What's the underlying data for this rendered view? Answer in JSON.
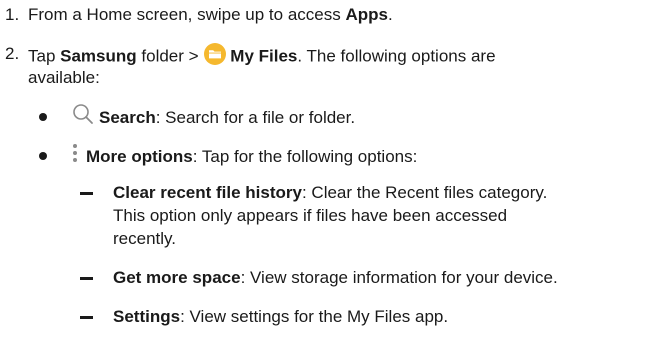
{
  "step1": {
    "number": "1.",
    "prefix": "From a Home screen, swipe up to access ",
    "bold": "Apps",
    "suffix": "."
  },
  "step2": {
    "number": "2.",
    "tap": "Tap ",
    "samsung": "Samsung",
    "folder_text": " folder > ",
    "folder_icon": "folder-icon",
    "myfiles": "My Files",
    "suffix_line1": ". The following options are",
    "line2": "available:"
  },
  "bullet1": {
    "icon": "search-icon",
    "label": "Search",
    "desc": ": Search for a file or folder."
  },
  "bullet2": {
    "icon": "more-options-icon",
    "label": "More options",
    "desc": ": Tap for the following options:"
  },
  "sub1": {
    "label": "Clear recent file history",
    "desc_line1": ": Clear the Recent files category.",
    "line2": "This option only appears if files have been accessed",
    "line3": "recently."
  },
  "sub2": {
    "label": "Get more space",
    "desc": ": View storage information for your device."
  },
  "sub3": {
    "label": "Settings",
    "desc": ": View settings for the My Files app."
  },
  "colors": {
    "text": "#1a1a1a",
    "folder_icon": "#f5b82e",
    "search_icon": "#8a8a8a"
  }
}
